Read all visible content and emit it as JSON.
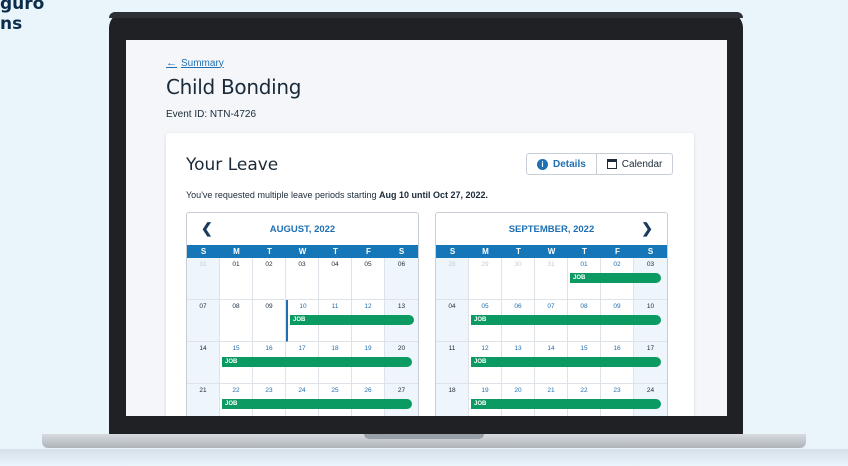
{
  "background": {
    "line1": "guro",
    "line2": "ns"
  },
  "back_link": "Summary",
  "page_title": "Child Bonding",
  "event_id": "Event ID: NTN-4726",
  "card": {
    "title": "Your Leave",
    "tabs": [
      {
        "label": "Details",
        "icon": "info-icon",
        "active": true
      },
      {
        "label": "Calendar",
        "icon": "calendar-icon",
        "active": false
      }
    ],
    "summary_prefix": "You've requested multiple leave periods starting ",
    "summary_bold": "Aug 10 until Oct 27, 2022."
  },
  "weekdays": [
    "S",
    "M",
    "T",
    "W",
    "T",
    "F",
    "S"
  ],
  "bar_label": "JOB",
  "calendars": [
    {
      "month": "AUGUST, 2022",
      "weeks": [
        [
          "31",
          "01",
          "02",
          "03",
          "04",
          "05",
          "06"
        ],
        [
          "07",
          "08",
          "09",
          "10",
          "11",
          "12",
          "13"
        ],
        [
          "14",
          "15",
          "16",
          "17",
          "18",
          "19",
          "20"
        ],
        [
          "21",
          "22",
          "23",
          "24",
          "25",
          "26",
          "27"
        ]
      ],
      "leave_days": [
        "10",
        "11",
        "12",
        "15",
        "16",
        "17",
        "18",
        "19",
        "22",
        "23",
        "24",
        "25",
        "26"
      ]
    },
    {
      "month": "SEPTEMBER, 2022",
      "weeks": [
        [
          "28",
          "29",
          "30",
          "31",
          "01",
          "02",
          "03"
        ],
        [
          "04",
          "05",
          "06",
          "07",
          "08",
          "09",
          "10"
        ],
        [
          "11",
          "12",
          "13",
          "14",
          "15",
          "16",
          "17"
        ],
        [
          "18",
          "19",
          "20",
          "21",
          "22",
          "23",
          "24"
        ]
      ],
      "leave_days": [
        "01",
        "02",
        "05",
        "06",
        "07",
        "08",
        "09",
        "12",
        "13",
        "14",
        "15",
        "16",
        "19",
        "20",
        "21",
        "22",
        "23"
      ]
    }
  ],
  "colors": {
    "accent": "#1f6fb2",
    "header_bar": "#1577b7",
    "leave_bar": "#0c9a63"
  }
}
